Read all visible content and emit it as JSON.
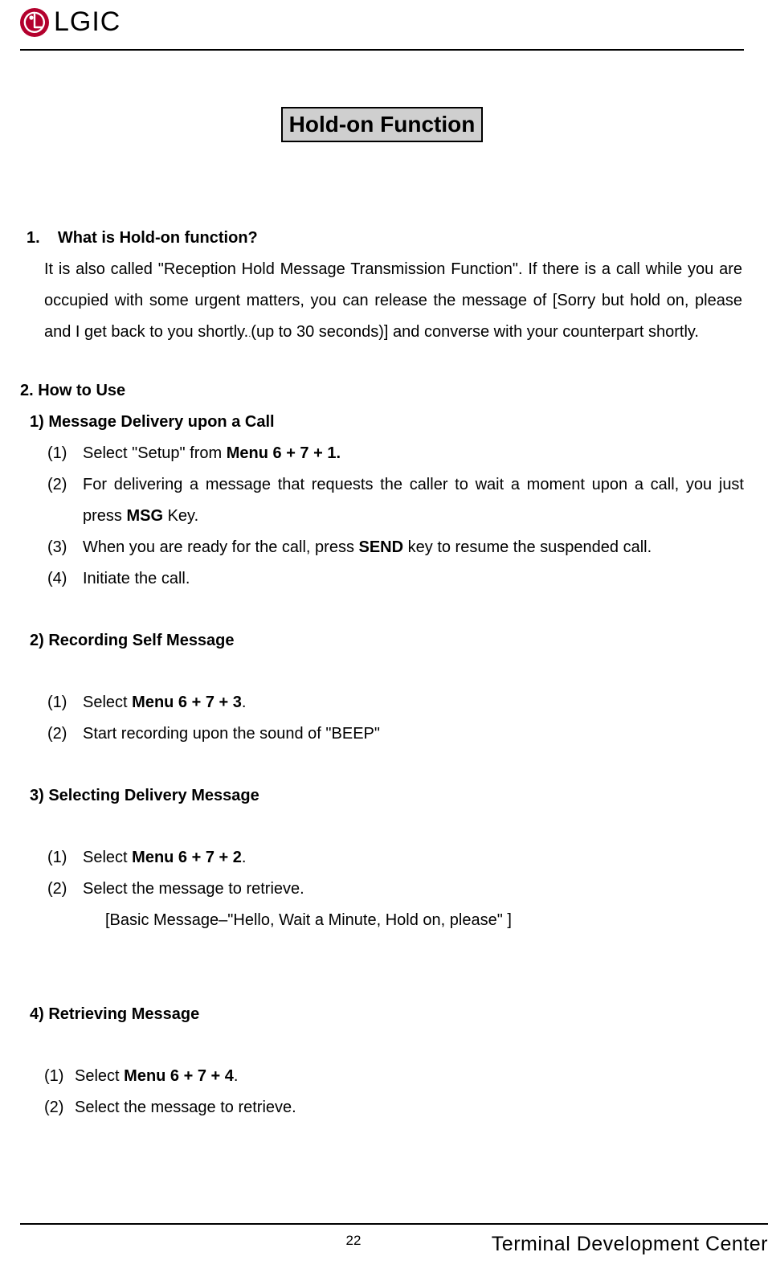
{
  "header": {
    "logo_text": "LGIC",
    "logo_icon": "lg-face-logo"
  },
  "title": "Hold-on Function",
  "section1": {
    "number": "1.",
    "heading": "What is Hold-on function?",
    "body_before_dot": "It is also called \"Reception Hold Message Transmission Function\". If there is a call while you are occupied with some urgent matters, you can release the message of [Sorry but hold on, please and I get back to you shortly.",
    "body_after_dot": "(up to 30 seconds)] and converse with your counterpart shortly."
  },
  "section2": {
    "heading": "2. How to Use",
    "sub1": {
      "heading": "1) Message Delivery upon a Call",
      "items": [
        {
          "n": "(1)",
          "pre": "Select \"Setup\" from ",
          "bold": "Menu 6 + 7 + 1.",
          "post": ""
        },
        {
          "n": "(2)",
          "pre": "For delivering a message that requests the caller to wait a moment upon a call, you just press ",
          "bold": "MSG",
          "post": " Key."
        },
        {
          "n": "(3)",
          "pre": "When you are ready for the call, press ",
          "bold": "SEND",
          "post": " key to resume the suspended call."
        },
        {
          "n": "(4)",
          "pre": "Initiate the call.",
          "bold": "",
          "post": ""
        }
      ]
    },
    "sub2": {
      "heading": "2) Recording Self Message",
      "items": [
        {
          "n": "(1)",
          "pre": "Select ",
          "bold": "Menu 6 + 7 + 3",
          "post": "."
        },
        {
          "n": "(2)",
          "pre": "Start recording upon the sound of \"BEEP\"",
          "bold": "",
          "post": ""
        }
      ]
    },
    "sub3": {
      "heading": "3) Selecting Delivery Message",
      "items": [
        {
          "n": "(1)",
          "pre": "Select ",
          "bold": "Menu 6 + 7 + 2",
          "post": "."
        },
        {
          "n": "(2)",
          "pre": "Select the message to retrieve.",
          "bold": "",
          "post": ""
        }
      ],
      "note": "[Basic Message–\"Hello, Wait a Minute, Hold on, please\" ]"
    },
    "sub4": {
      "heading": "4) Retrieving Message",
      "items": [
        {
          "n": "(1)",
          "pre": "Select ",
          "bold": "Menu 6 + 7 + 4",
          "post": "."
        },
        {
          "n": "(2)",
          "pre": "Select the message to retrieve.",
          "bold": "",
          "post": ""
        }
      ]
    }
  },
  "footer": {
    "page_number": "22",
    "right": "Terminal Development Center"
  }
}
